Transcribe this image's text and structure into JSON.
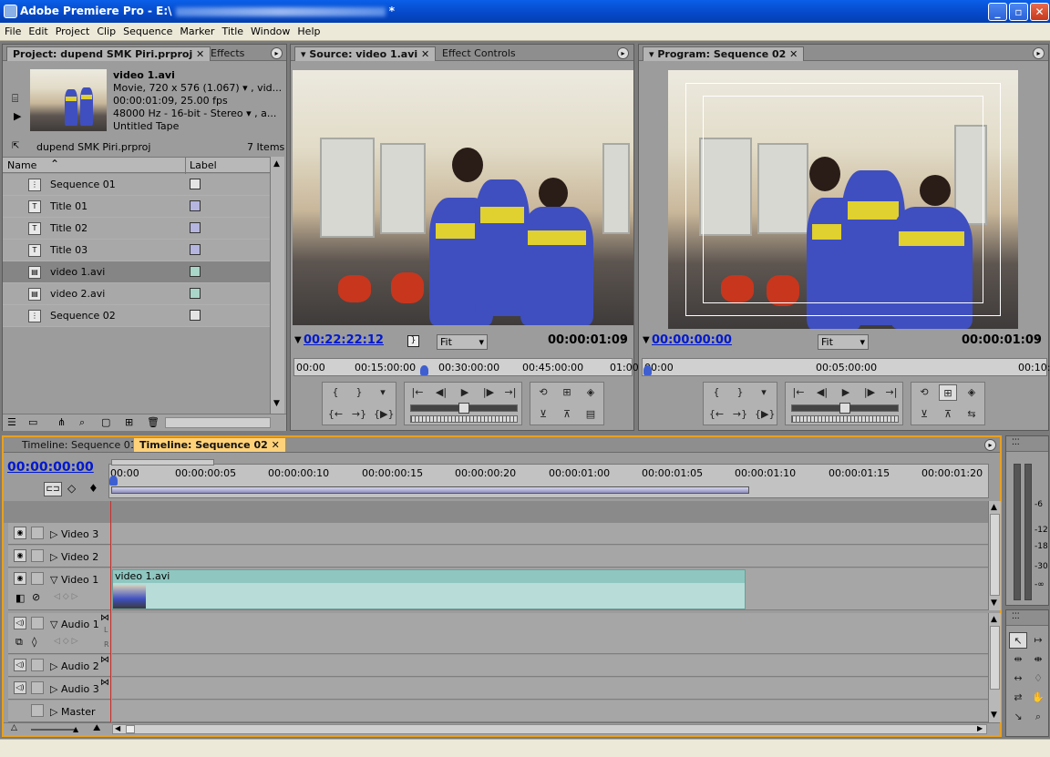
{
  "window": {
    "title": "Adobe Premiere Pro - E:\\",
    "title_suffix": " *",
    "min": "_",
    "max": "▫",
    "close": "✕"
  },
  "menu": [
    "File",
    "Edit",
    "Project",
    "Clip",
    "Sequence",
    "Marker",
    "Title",
    "Window",
    "Help"
  ],
  "project": {
    "tabs": [
      "Project: dupend SMK Piri.prproj",
      "Effects"
    ],
    "clip_name": "video 1.avi",
    "clip_info": [
      "Movie, 720 x 576 (1.067)  ▾ , vid...",
      "00:00:01:09, 25.00 fps",
      "48000 Hz - 16-bit - Stereo  ▾ , a...",
      "Untitled Tape"
    ],
    "project_file": "dupend SMK Piri.prproj",
    "items_count": "7 Items",
    "col_name": "Name",
    "col_label": "Label",
    "items": [
      {
        "name": "Sequence 01",
        "icon": "sequence-icon",
        "color": "#e4e4e4"
      },
      {
        "name": "Title 01",
        "icon": "title-icon",
        "color": "#b5b5e0"
      },
      {
        "name": "Title 02",
        "icon": "title-icon",
        "color": "#b5b5e0"
      },
      {
        "name": "Title 03",
        "icon": "title-icon",
        "color": "#b5b5e0"
      },
      {
        "name": "video 1.avi",
        "icon": "movie-icon",
        "color": "#a9d6c8",
        "selected": true
      },
      {
        "name": "video 2.avi",
        "icon": "movie-icon",
        "color": "#a9d6c8"
      },
      {
        "name": "Sequence 02",
        "icon": "sequence-icon",
        "color": "#e4e4e4"
      }
    ]
  },
  "source": {
    "tabs": [
      "Source: video 1.avi",
      "Effect Controls"
    ],
    "timecode_left": "00:22:22:12",
    "fit": "Fit",
    "timecode_right": "00:00:01:09",
    "ruler": [
      "00:00",
      "00:15:00:00",
      "00:30:00:00",
      "00:45:00:00",
      "01:00"
    ]
  },
  "program": {
    "tab": "Program: Sequence 02",
    "timecode_left": "00:00:00:00",
    "fit": "Fit",
    "timecode_right": "00:00:01:09",
    "ruler": [
      "00:00",
      "00:05:00:00",
      "00:10:"
    ]
  },
  "timeline": {
    "tabs": [
      "Timeline: Sequence 01",
      "Timeline: Sequence 02"
    ],
    "timecode": "00:00:00:00",
    "ruler": [
      "00:00",
      "00:00:00:05",
      "00:00:00:10",
      "00:00:00:15",
      "00:00:00:20",
      "00:00:01:00",
      "00:00:01:05",
      "00:00:01:10",
      "00:00:01:15",
      "00:00:01:20"
    ],
    "video_tracks": [
      "Video 3",
      "Video 2",
      "Video 1"
    ],
    "audio_tracks": [
      "Audio 1",
      "Audio 2",
      "Audio 3",
      "Master"
    ],
    "clip_label": "video 1.avi",
    "lr": [
      "L",
      "R"
    ]
  },
  "meter": {
    "labels": [
      "-6",
      "-12",
      "-18",
      "-30",
      "-∞"
    ]
  },
  "colors": {
    "accent": "#e8a020",
    "clip": "#b8dcd8",
    "timecode_link": "#0018d0"
  }
}
